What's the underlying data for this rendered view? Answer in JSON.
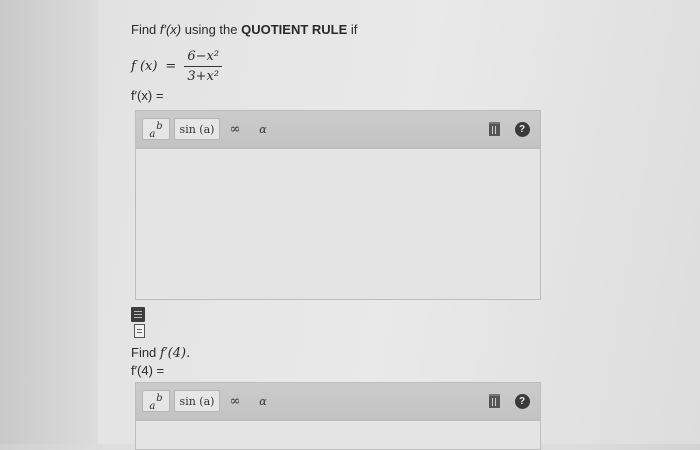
{
  "question": {
    "prefix": "Find ",
    "fprime": "f′(x)",
    "middle": " using the ",
    "rule": "QUOTIENT RULE",
    "suffix": " if"
  },
  "function": {
    "lhs": "f (x)",
    "eq": "=",
    "numerator": "6−x²",
    "denominator": "3+x²"
  },
  "answer1_label": "f′(x) =",
  "toolbar": {
    "power_base": "a",
    "power_exp": "b",
    "sin_label": "sin (a)",
    "infinity_label": "∞",
    "alpha_label": "α",
    "help_label": "?",
    "trash_icon": "trash-icon",
    "help_icon": "question-circle-icon"
  },
  "attachments": {
    "icon1": "document-dark-icon",
    "icon2": "document-icon"
  },
  "question2": {
    "prefix": "Find ",
    "text": "f′(4)."
  },
  "answer2_label": "f′(4) ="
}
